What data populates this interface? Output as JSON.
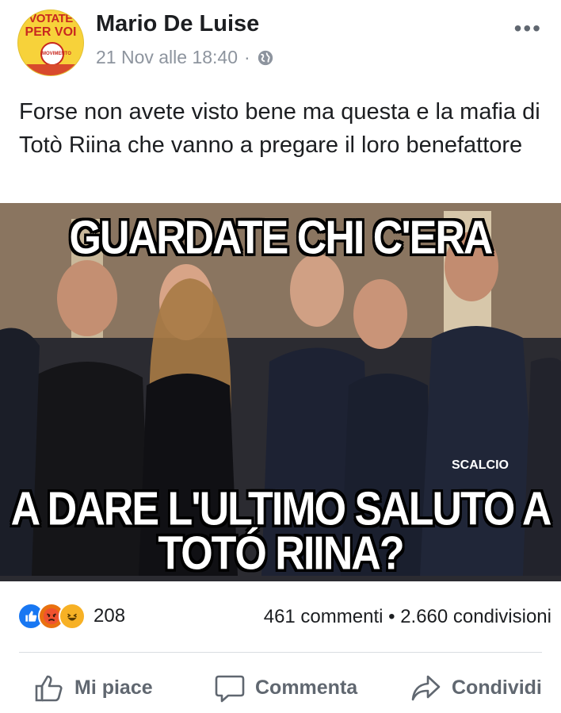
{
  "post": {
    "avatar": {
      "line1": "VOTATE",
      "line2": "PER VOI",
      "badge_text": "MOVIMENTO"
    },
    "author": "Mario De Luise",
    "timestamp": "21 Nov alle 18:40",
    "separator": "·",
    "privacy_icon": "globe-icon",
    "more_icon": "more-options-icon",
    "more_symbol": "•••",
    "text": "Forse non avete visto bene ma questa e la mafia di Totò Riina che vanno a pregare il loro benefattore"
  },
  "image": {
    "caption_top": "GUARDATE CHI C'ERA",
    "caption_bottom_line1": "A DARE L'ULTIMO SALUTO A",
    "caption_bottom_line2": "TOTÓ RIINA?",
    "signature": "SCALCIO"
  },
  "stats": {
    "reaction_icons": [
      "like-reaction-icon",
      "angry-reaction-icon",
      "haha-reaction-icon"
    ],
    "reactions_count": "208",
    "comments_shares": "461 commenti • 2.660 condivisioni"
  },
  "actions": {
    "like": "Mi piace",
    "comment": "Commenta",
    "share": "Condividi"
  },
  "colors": {
    "accent": "#1877f2",
    "secondary_text": "#606770"
  }
}
